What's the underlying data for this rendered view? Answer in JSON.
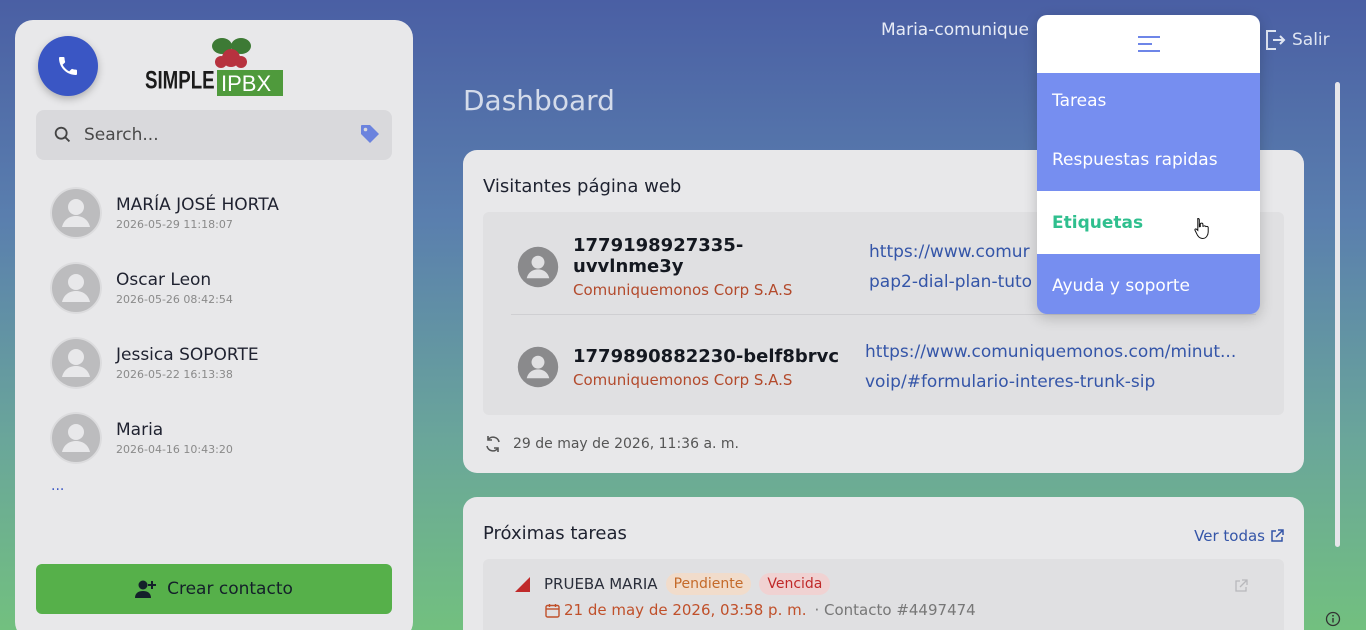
{
  "sidebar": {
    "logo_text": "SIMPLE IPBX",
    "search_placeholder": "Search...",
    "contacts": [
      {
        "name": "MARÍA JOSÉ HORTA",
        "date": "2026-05-29 11:18:07"
      },
      {
        "name": "Oscar Leon",
        "date": "2026-05-26 08:42:54"
      },
      {
        "name": "Jessica SOPORTE",
        "date": "2026-05-22 16:13:38"
      },
      {
        "name": "Maria",
        "date": "2026-04-16 10:43:20"
      }
    ],
    "more": "...",
    "create_contact": "Crear contacto"
  },
  "header": {
    "user": "Maria-comunique",
    "logout": "Salir"
  },
  "page_title": "Dashboard",
  "visitors": {
    "title": "Visitantes página web",
    "items": [
      {
        "id": "1779198927335-uvvlnme3y",
        "company": "Comuniquemonos Corp S.A.S",
        "url1": "https://www.comur",
        "url2": "pap2-dial-plan-tuto"
      },
      {
        "id": "1779890882230-belf8brvc",
        "company": "Comuniquemonos Corp S.A.S",
        "url1": "https://www.comuniquemonos.com/minut...",
        "url2": "voip/#formulario-interes-trunk-sip"
      }
    ],
    "updated": "29 de may de 2026, 11:36 a. m."
  },
  "tasks": {
    "title": "Próximas tareas",
    "see_all": "Ver todas",
    "items": [
      {
        "name": "PRUEBA MARIA",
        "status": "Pendiente",
        "flag": "Vencida",
        "date": "21 de may de 2026, 03:58 p. m.",
        "contact": "· Contacto #4497474"
      }
    ]
  },
  "menu": {
    "items": [
      {
        "label": "Tareas"
      },
      {
        "label": "Respuestas rapidas"
      },
      {
        "label": "Etiquetas"
      },
      {
        "label": "Ayuda y soporte"
      }
    ]
  },
  "colors": {
    "accent": "#3a56c4",
    "menu_bg": "#768ef0",
    "menu_active_text": "#2fbf8e",
    "create_button": "#56b04a"
  }
}
